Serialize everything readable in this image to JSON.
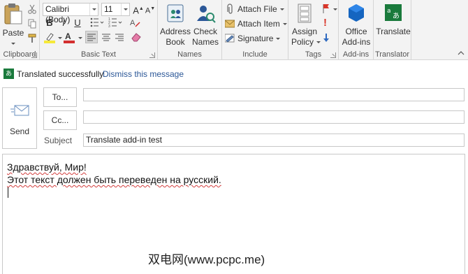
{
  "ribbon": {
    "clipboard": {
      "paste_label": "Paste",
      "group_label": "Clipboard"
    },
    "basic_text": {
      "font_name": "Calibri (Body)",
      "font_size": "11",
      "grow_font": "A",
      "shrink_font": "A",
      "bold": "B",
      "italic": "I",
      "underline": "U",
      "highlight_color": "#f6e93a",
      "font_color": "#d32f2f",
      "group_label": "Basic Text"
    },
    "names": {
      "address_book": [
        "Address",
        "Book"
      ],
      "check_names": [
        "Check",
        "Names"
      ],
      "group_label": "Names"
    },
    "include": {
      "attach_file": "Attach File",
      "attach_item": "Attach Item",
      "signature": "Signature",
      "group_label": "Include"
    },
    "tags": {
      "assign_policy": [
        "Assign",
        "Policy"
      ],
      "high_importance": "!",
      "group_label": "Tags"
    },
    "addins": {
      "office_addins": [
        "Office",
        "Add-ins"
      ],
      "group_label": "Add-ins"
    },
    "translator": {
      "translate": "Translate",
      "group_label": "Translator"
    }
  },
  "notice": {
    "message": "Translated successfully",
    "dismiss": "Dismiss this message"
  },
  "compose": {
    "send_label": "Send",
    "to_label": "To...",
    "cc_label": "Cc...",
    "subject_label": "Subject",
    "subject_value": "Translate add-in test",
    "body_lines": [
      "Здравствуй, Мир!",
      "Этот текст должен быть переведен на русский."
    ]
  },
  "watermark": "双电网(www.pcpc.me)",
  "colors": {
    "accent": "#2b5797",
    "translator_green": "#1a7a3c",
    "addins_blue": "#1565c0"
  }
}
